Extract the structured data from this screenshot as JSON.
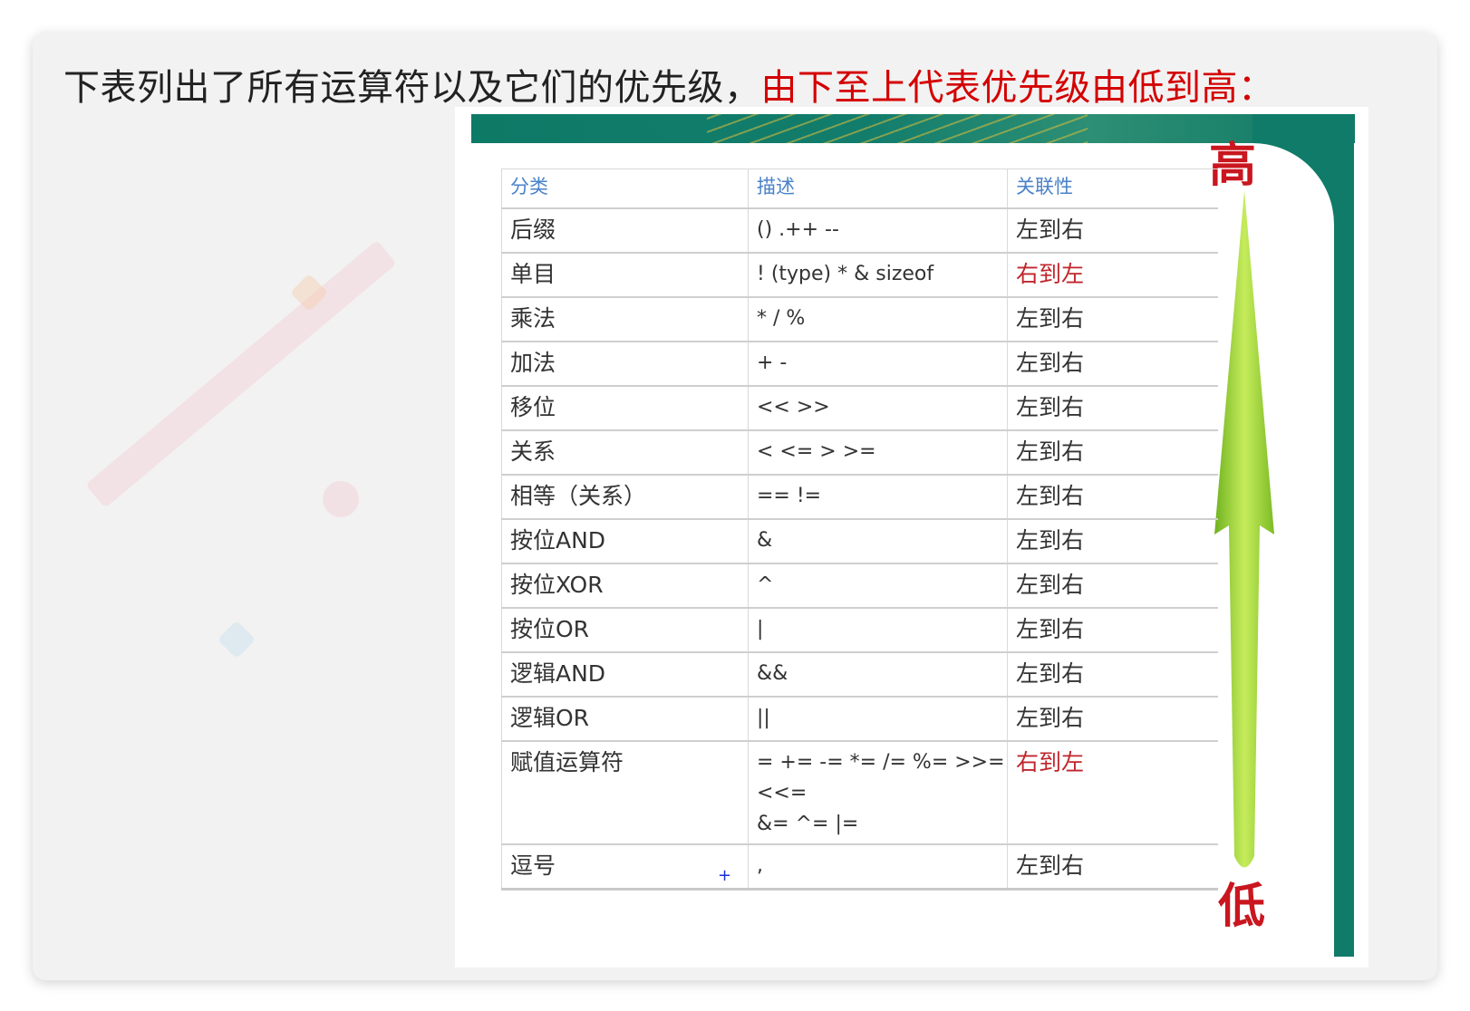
{
  "heading": {
    "plain": "下表列出了所有运算符以及它们的优先级，",
    "highlight": "由下至上代表优先级由低到高："
  },
  "labels": {
    "high": "高",
    "low": "低"
  },
  "table": {
    "headers": [
      "分类",
      "描述",
      "关联性"
    ],
    "rows": [
      {
        "category": "后缀",
        "description": "()  .++ --",
        "assoc": "左到右"
      },
      {
        "category": "单目",
        "description": "!  (type) * & sizeof",
        "assoc": "右到左"
      },
      {
        "category": "乘法",
        "description": "* / %",
        "assoc": "左到右"
      },
      {
        "category": "加法",
        "description": "+ -",
        "assoc": "左到右"
      },
      {
        "category": "移位",
        "description": "<< >>",
        "assoc": "左到右"
      },
      {
        "category": "关系",
        "description": "< <= > >=",
        "assoc": "左到右"
      },
      {
        "category": "相等（关系）",
        "description": "== !=",
        "assoc": "左到右"
      },
      {
        "category": "按位AND",
        "description": "&",
        "assoc": "左到右"
      },
      {
        "category": "按位XOR",
        "description": "^",
        "assoc": "左到右"
      },
      {
        "category": "按位OR",
        "description": "|",
        "assoc": "左到右"
      },
      {
        "category": "逻辑AND",
        "description": "&&",
        "assoc": "左到右"
      },
      {
        "category": "逻辑OR",
        "description": "||",
        "assoc": "左到右"
      },
      {
        "category": "赋值运算符",
        "description_lines": [
          "= += -= *= /= %= >>=",
          "<<=",
          "&= ^= |="
        ],
        "assoc": "右到左"
      },
      {
        "category": "逗号",
        "description": ",",
        "assoc": "左到右"
      }
    ]
  },
  "colors": {
    "highlight": "#d40000",
    "header_text": "#4a82c8",
    "assoc_red": "#c0262c",
    "frame_green": "#0f7b68",
    "arrow": "#9acd32"
  },
  "cursor_glyph": "+"
}
